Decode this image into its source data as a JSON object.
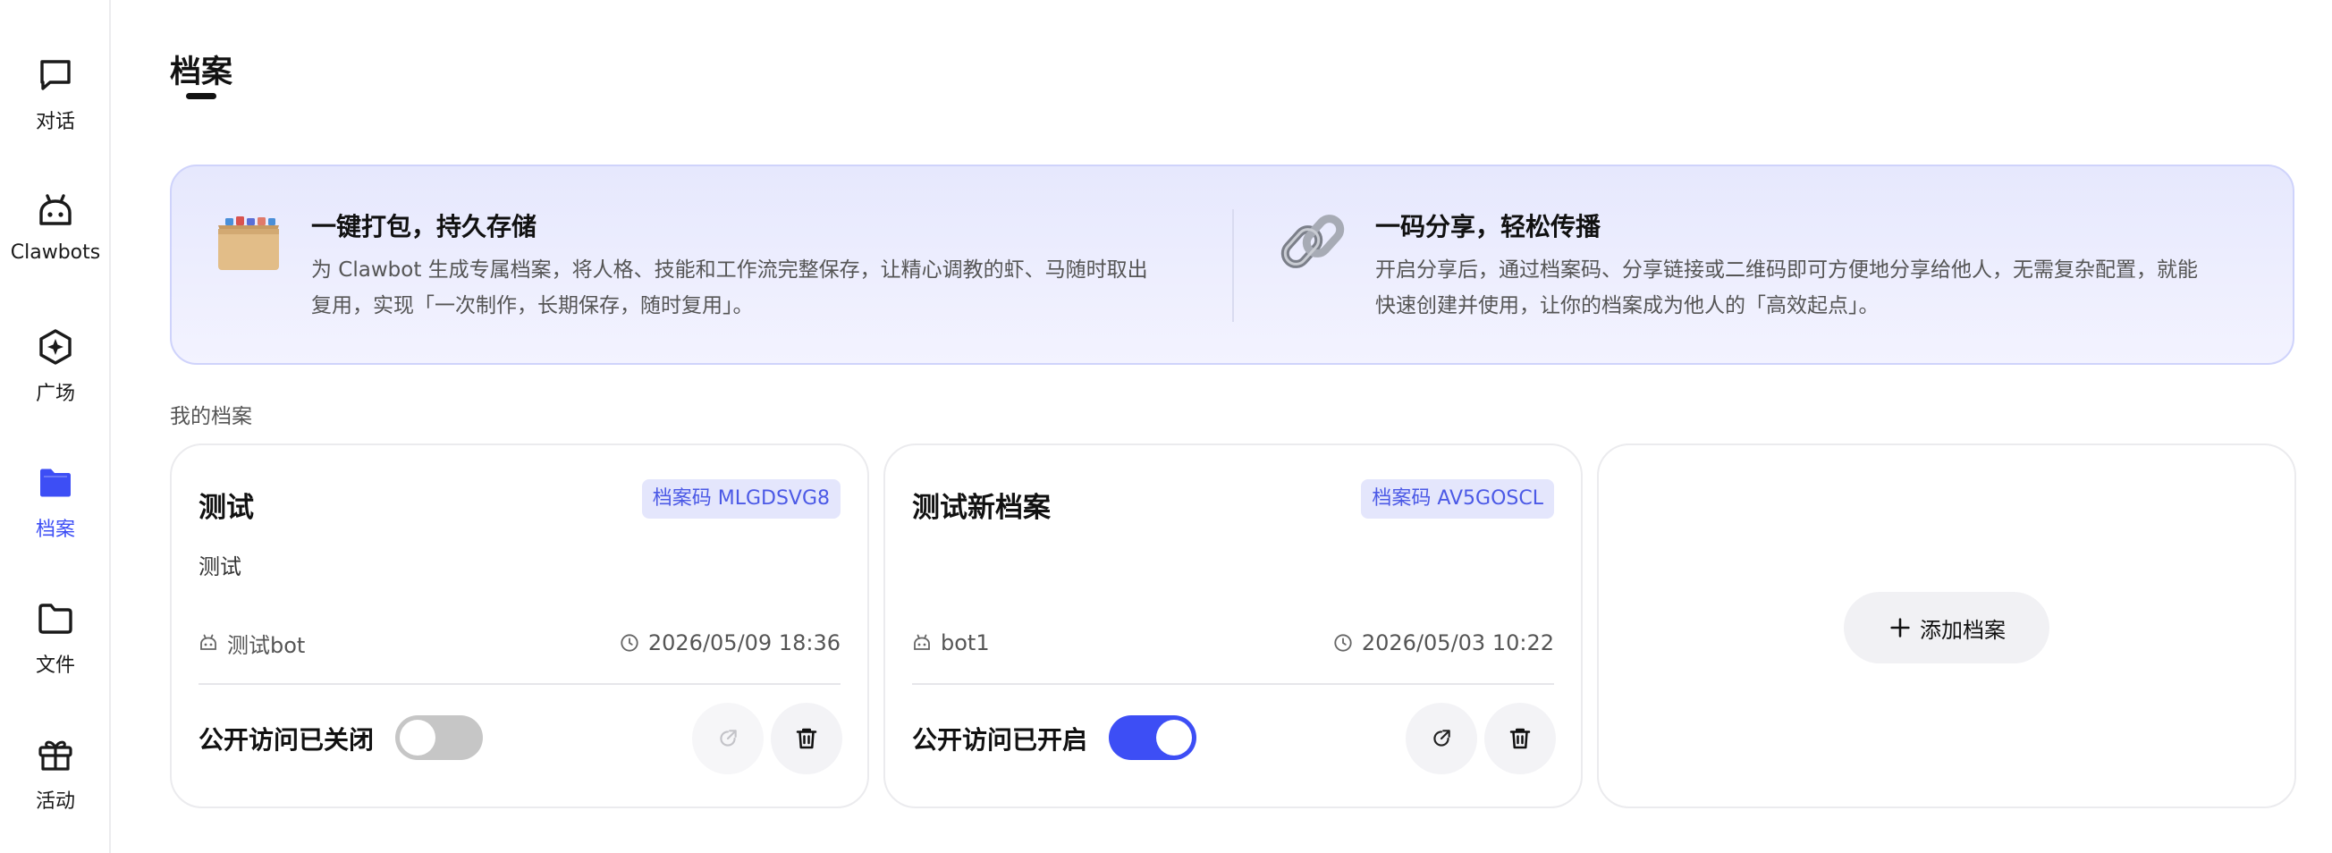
{
  "sidebar": {
    "items": [
      {
        "label": "对话",
        "icon": "chat-icon",
        "active": false
      },
      {
        "label": "Clawbots",
        "icon": "bot-icon",
        "active": false
      },
      {
        "label": "广场",
        "icon": "plaza-icon",
        "active": false
      },
      {
        "label": "档案",
        "icon": "folder-icon",
        "active": true
      },
      {
        "label": "文件",
        "icon": "file-folder-icon",
        "active": false
      },
      {
        "label": "活动",
        "icon": "gift-icon",
        "active": false
      }
    ]
  },
  "header": {
    "title": "档案"
  },
  "banner": {
    "features": [
      {
        "title": "一键打包，持久存储",
        "desc_line1": "为 Clawbot 生成专属档案，将人格、技能和工作流完整保存，让精心调教的虾、马随时取出",
        "desc_line2": "复用，实现「一次制作，长期保存，随时复用」。",
        "icon": "archive-box-icon"
      },
      {
        "title": "一码分享，轻松传播",
        "desc_line1": "开启分享后，通过档案码、分享链接或二维码即可方便地分享给他人，无需复杂配置，就能",
        "desc_line2": "快速创建并使用，让你的档案成为他人的「高效起点」。",
        "icon": "chain-link-icon"
      }
    ]
  },
  "section": {
    "label": "我的档案"
  },
  "archives": [
    {
      "name": "测试",
      "code_label": "档案码 MLGDSVG8",
      "desc": "测试",
      "bot": "测试bot",
      "time": "2026/05/09 18:36",
      "access_label": "公开访问已关闭",
      "public": false
    },
    {
      "name": "测试新档案",
      "code_label": "档案码 AV5GOSCL",
      "desc": "",
      "bot": "bot1",
      "time": "2026/05/03 10:22",
      "access_label": "公开访问已开启",
      "public": true
    }
  ],
  "add_card": {
    "label": "添加档案"
  },
  "colors": {
    "accent": "#3d4ef5",
    "code_bg": "#e4e6fc",
    "toggle_off": "#c6c6c6"
  }
}
